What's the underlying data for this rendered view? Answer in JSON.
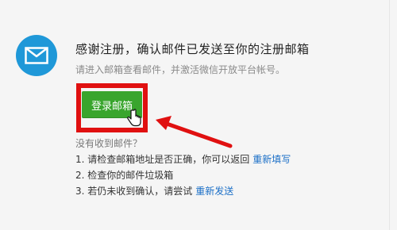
{
  "notice": {
    "title": "感谢注册，确认邮件已发送至你的注册邮箱",
    "subtitle": "请进入邮箱查看邮件，并激活微信开放平台帐号。"
  },
  "actions": {
    "login_button_label": "登录邮箱"
  },
  "help": {
    "heading": "没有收到邮件？",
    "items": [
      {
        "text": "1. 请检查邮箱地址是否正确，你可以返回",
        "link": "重新填写"
      },
      {
        "text": "2. 检查你的邮件垃圾箱",
        "link": ""
      },
      {
        "text": "3. 若仍未收到确认，请尝试",
        "link": "重新发送"
      }
    ]
  },
  "colors": {
    "icon_bg": "#1f98d8",
    "button": "#39a52d",
    "highlight": "#e01010",
    "link": "#1b6fc7"
  },
  "icons": {
    "mail": "envelope-icon",
    "cursor": "hand-pointer-icon"
  }
}
